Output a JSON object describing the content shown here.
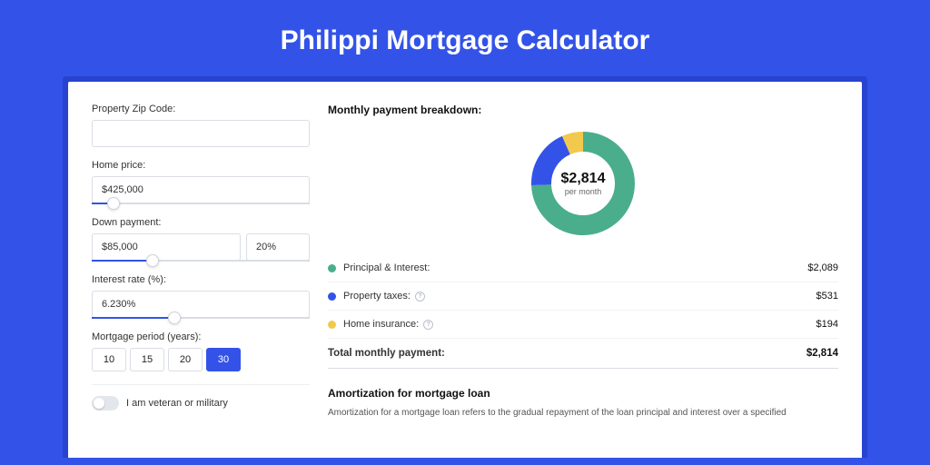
{
  "title": "Philippi Mortgage Calculator",
  "left": {
    "zip": {
      "label": "Property Zip Code:",
      "value": ""
    },
    "home": {
      "label": "Home price:",
      "value": "$425,000",
      "slider_pct": 10
    },
    "down": {
      "label": "Down payment:",
      "amount": "$85,000",
      "pct": "20%",
      "slider_pct": 28
    },
    "rate": {
      "label": "Interest rate (%):",
      "value": "6.230%",
      "slider_pct": 38
    },
    "period": {
      "label": "Mortgage period (years):",
      "options": [
        "10",
        "15",
        "20",
        "30"
      ],
      "active": "30"
    },
    "veteran": {
      "label": "I am veteran or military"
    }
  },
  "right": {
    "breakdown_title": "Monthly payment breakdown:",
    "center_value": "$2,814",
    "center_sub": "per month",
    "items": [
      {
        "name": "Principal & Interest:",
        "value": "$2,089",
        "color": "#4aae8c",
        "info": false
      },
      {
        "name": "Property taxes:",
        "value": "$531",
        "color": "#3353e8",
        "info": true
      },
      {
        "name": "Home insurance:",
        "value": "$194",
        "color": "#f2c94c",
        "info": true
      }
    ],
    "total": {
      "name": "Total monthly payment:",
      "value": "$2,814"
    },
    "amort": {
      "title": "Amortization for mortgage loan",
      "text": "Amortization for a mortgage loan refers to the gradual repayment of the loan principal and interest over a specified"
    }
  },
  "colors": {
    "green": "#4aae8c",
    "blue": "#3353e8",
    "yellow": "#f2c94c"
  },
  "chart_data": {
    "type": "pie",
    "title": "Monthly payment breakdown",
    "series": [
      {
        "name": "Principal & Interest",
        "value": 2089,
        "color": "#4aae8c"
      },
      {
        "name": "Property taxes",
        "value": 531,
        "color": "#3353e8"
      },
      {
        "name": "Home insurance",
        "value": 194,
        "color": "#f2c94c"
      }
    ],
    "total": 2814
  }
}
